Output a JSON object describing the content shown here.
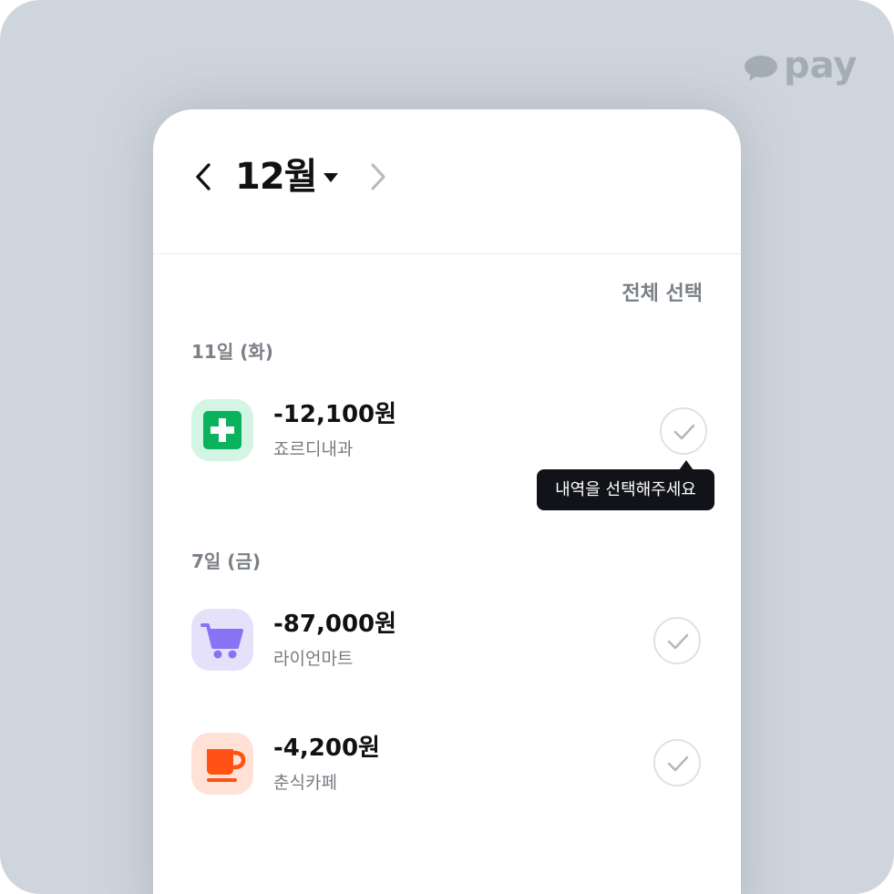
{
  "brand": {
    "logo_text": "pay",
    "logo_icon": "speech-bubble-icon"
  },
  "header": {
    "month": "12월",
    "prev_icon": "chevron-left-icon",
    "next_icon": "chevron-right-icon",
    "dropdown_icon": "caret-down-icon"
  },
  "select_all_label": "전체 선택",
  "groups": [
    {
      "date": "11일 (화)",
      "items": [
        {
          "amount": "-12,100원",
          "merchant": "죠르디내과",
          "icon": "hospital-cross-icon",
          "icon_bg": "#d3f5e3",
          "icon_color": "#0bb25e"
        }
      ]
    },
    {
      "date": "7일 (금)",
      "items": [
        {
          "amount": "-87,000원",
          "merchant": "라이언마트",
          "icon": "shopping-cart-icon",
          "icon_bg": "#e6e1fb",
          "icon_color": "#8a72f5"
        },
        {
          "amount": "-4,200원",
          "merchant": "춘식카페",
          "icon": "coffee-cup-icon",
          "icon_bg": "#ffe1d6",
          "icon_color": "#ff5214"
        }
      ]
    }
  ],
  "tooltip": {
    "text": "내역을 선택해주세요"
  },
  "colors": {
    "background": "#cfd5dc",
    "card": "#ffffff",
    "text_primary": "#111111",
    "text_secondary": "#7b7f86",
    "check_border": "#dfe1e4"
  }
}
